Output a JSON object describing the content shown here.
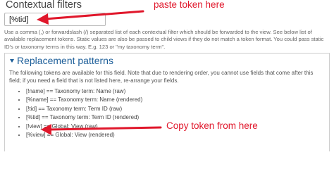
{
  "contextual_filters": {
    "heading": "Contextual filters",
    "field_value": "[%tid]",
    "help_text": "Use a comma (,) or forwardslash (/) separated list of each contextual filter which should be forwarded to the view. See below list of available replacement tokens. Static values are also be passed to child views if they do not match a token format. You could pass static ID's or taxonomy terms in this way. E.g. 123 or \"my taxonomy term\"."
  },
  "replacement_patterns": {
    "title": "Replacement patterns",
    "description": "The following tokens are available for this field. Note that due to rendering order, you cannot use fields that come after this field; if you need a field that is not listed here, re-arrange your fields.",
    "tokens": [
      "[!name] == Taxonomy term: Name (raw)",
      "[%name] == Taxonomy term: Name (rendered)",
      "[!tid] == Taxonomy term: Term ID (raw)",
      "[%tid] == Taxonomy term: Term ID (rendered)",
      "[!view] == Global: View (raw)",
      "[%view] == Global: View (rendered)"
    ]
  },
  "annotations": {
    "paste_label": "paste token here",
    "copy_label": "Copy token from here",
    "color": "#e0172b"
  }
}
